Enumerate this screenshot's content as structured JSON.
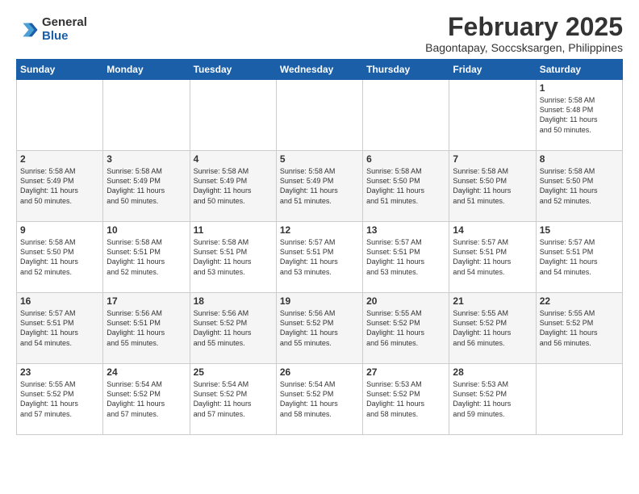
{
  "header": {
    "logo": {
      "general": "General",
      "blue": "Blue"
    },
    "title": "February 2025",
    "location": "Bagontapay, Soccsksargen, Philippines"
  },
  "weekdays": [
    "Sunday",
    "Monday",
    "Tuesday",
    "Wednesday",
    "Thursday",
    "Friday",
    "Saturday"
  ],
  "weeks": [
    [
      {
        "day": "",
        "info": ""
      },
      {
        "day": "",
        "info": ""
      },
      {
        "day": "",
        "info": ""
      },
      {
        "day": "",
        "info": ""
      },
      {
        "day": "",
        "info": ""
      },
      {
        "day": "",
        "info": ""
      },
      {
        "day": "1",
        "info": "Sunrise: 5:58 AM\nSunset: 5:48 PM\nDaylight: 11 hours\nand 50 minutes."
      }
    ],
    [
      {
        "day": "2",
        "info": "Sunrise: 5:58 AM\nSunset: 5:49 PM\nDaylight: 11 hours\nand 50 minutes."
      },
      {
        "day": "3",
        "info": "Sunrise: 5:58 AM\nSunset: 5:49 PM\nDaylight: 11 hours\nand 50 minutes."
      },
      {
        "day": "4",
        "info": "Sunrise: 5:58 AM\nSunset: 5:49 PM\nDaylight: 11 hours\nand 50 minutes."
      },
      {
        "day": "5",
        "info": "Sunrise: 5:58 AM\nSunset: 5:49 PM\nDaylight: 11 hours\nand 51 minutes."
      },
      {
        "day": "6",
        "info": "Sunrise: 5:58 AM\nSunset: 5:50 PM\nDaylight: 11 hours\nand 51 minutes."
      },
      {
        "day": "7",
        "info": "Sunrise: 5:58 AM\nSunset: 5:50 PM\nDaylight: 11 hours\nand 51 minutes."
      },
      {
        "day": "8",
        "info": "Sunrise: 5:58 AM\nSunset: 5:50 PM\nDaylight: 11 hours\nand 52 minutes."
      }
    ],
    [
      {
        "day": "9",
        "info": "Sunrise: 5:58 AM\nSunset: 5:50 PM\nDaylight: 11 hours\nand 52 minutes."
      },
      {
        "day": "10",
        "info": "Sunrise: 5:58 AM\nSunset: 5:51 PM\nDaylight: 11 hours\nand 52 minutes."
      },
      {
        "day": "11",
        "info": "Sunrise: 5:58 AM\nSunset: 5:51 PM\nDaylight: 11 hours\nand 53 minutes."
      },
      {
        "day": "12",
        "info": "Sunrise: 5:57 AM\nSunset: 5:51 PM\nDaylight: 11 hours\nand 53 minutes."
      },
      {
        "day": "13",
        "info": "Sunrise: 5:57 AM\nSunset: 5:51 PM\nDaylight: 11 hours\nand 53 minutes."
      },
      {
        "day": "14",
        "info": "Sunrise: 5:57 AM\nSunset: 5:51 PM\nDaylight: 11 hours\nand 54 minutes."
      },
      {
        "day": "15",
        "info": "Sunrise: 5:57 AM\nSunset: 5:51 PM\nDaylight: 11 hours\nand 54 minutes."
      }
    ],
    [
      {
        "day": "16",
        "info": "Sunrise: 5:57 AM\nSunset: 5:51 PM\nDaylight: 11 hours\nand 54 minutes."
      },
      {
        "day": "17",
        "info": "Sunrise: 5:56 AM\nSunset: 5:51 PM\nDaylight: 11 hours\nand 55 minutes."
      },
      {
        "day": "18",
        "info": "Sunrise: 5:56 AM\nSunset: 5:52 PM\nDaylight: 11 hours\nand 55 minutes."
      },
      {
        "day": "19",
        "info": "Sunrise: 5:56 AM\nSunset: 5:52 PM\nDaylight: 11 hours\nand 55 minutes."
      },
      {
        "day": "20",
        "info": "Sunrise: 5:55 AM\nSunset: 5:52 PM\nDaylight: 11 hours\nand 56 minutes."
      },
      {
        "day": "21",
        "info": "Sunrise: 5:55 AM\nSunset: 5:52 PM\nDaylight: 11 hours\nand 56 minutes."
      },
      {
        "day": "22",
        "info": "Sunrise: 5:55 AM\nSunset: 5:52 PM\nDaylight: 11 hours\nand 56 minutes."
      }
    ],
    [
      {
        "day": "23",
        "info": "Sunrise: 5:55 AM\nSunset: 5:52 PM\nDaylight: 11 hours\nand 57 minutes."
      },
      {
        "day": "24",
        "info": "Sunrise: 5:54 AM\nSunset: 5:52 PM\nDaylight: 11 hours\nand 57 minutes."
      },
      {
        "day": "25",
        "info": "Sunrise: 5:54 AM\nSunset: 5:52 PM\nDaylight: 11 hours\nand 57 minutes."
      },
      {
        "day": "26",
        "info": "Sunrise: 5:54 AM\nSunset: 5:52 PM\nDaylight: 11 hours\nand 58 minutes."
      },
      {
        "day": "27",
        "info": "Sunrise: 5:53 AM\nSunset: 5:52 PM\nDaylight: 11 hours\nand 58 minutes."
      },
      {
        "day": "28",
        "info": "Sunrise: 5:53 AM\nSunset: 5:52 PM\nDaylight: 11 hours\nand 59 minutes."
      },
      {
        "day": "",
        "info": ""
      }
    ]
  ]
}
